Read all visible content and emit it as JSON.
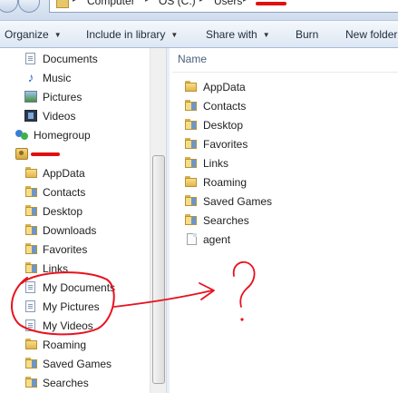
{
  "address_bar": {
    "crumbs": [
      "Computer",
      "OS (C:)",
      "Users"
    ]
  },
  "toolbar": {
    "organize": "Organize",
    "include_in_library": "Include in library",
    "share_with": "Share with",
    "burn": "Burn",
    "new_folder": "New folder"
  },
  "nav": {
    "library_items": [
      "Documents",
      "Music",
      "Pictures",
      "Videos"
    ],
    "homegroup": "Homegroup",
    "user_items": [
      "AppData",
      "Contacts",
      "Desktop",
      "Downloads",
      "Favorites",
      "Links",
      "My Documents",
      "My Pictures",
      "My Videos",
      "Roaming",
      "Saved Games",
      "Searches"
    ]
  },
  "content": {
    "column_header": "Name",
    "items": [
      "AppData",
      "Contacts",
      "Desktop",
      "Favorites",
      "Links",
      "Roaming",
      "Saved Games",
      "Searches",
      "agent"
    ]
  },
  "annotation": {
    "text": "?",
    "color": "#e8121f"
  },
  "colors": {
    "toolbar_bg": "#dde7f3",
    "redaction": "#e01010",
    "folder": "#e4b64c"
  }
}
